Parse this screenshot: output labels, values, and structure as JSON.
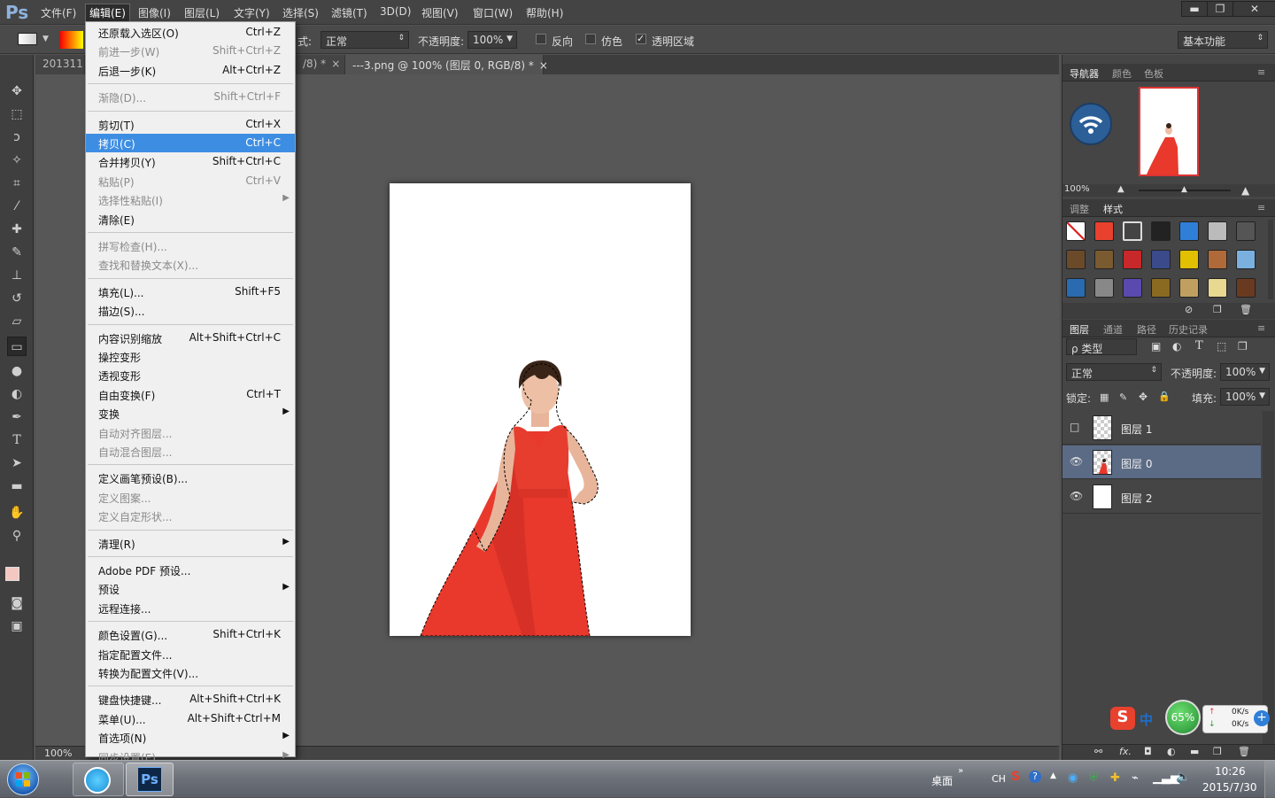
{
  "app": {
    "logo": "Ps"
  },
  "menubar": {
    "items": [
      "文件(F)",
      "编辑(E)",
      "图像(I)",
      "图层(L)",
      "文字(Y)",
      "选择(S)",
      "滤镜(T)",
      "3D(D)",
      "视图(V)",
      "窗口(W)",
      "帮助(H)"
    ],
    "active_index": 1,
    "window_buttons": {
      "minimize": "▬",
      "restore": "❐",
      "close": "✕"
    }
  },
  "options": {
    "mode_label": "式:",
    "mode_value": "正常",
    "opacity_label": "不透明度:",
    "opacity_value": "100%",
    "reverse_label": "反向",
    "dither_label": "仿色",
    "transparency_label": "透明区域",
    "transparency_checked": true,
    "workspace_value": "基本功能"
  },
  "tabs": [
    {
      "label": "201311"
    },
    {
      "label": "/8) *"
    },
    {
      "label": "---3.png @ 100% (图层 0, RGB/8) *"
    }
  ],
  "status": {
    "zoom": "100%"
  },
  "edit_menu": {
    "groups": [
      [
        {
          "label": "还原载入选区(O)",
          "shortcut": "Ctrl+Z",
          "enabled": true
        },
        {
          "label": "前进一步(W)",
          "shortcut": "Shift+Ctrl+Z",
          "enabled": false
        },
        {
          "label": "后退一步(K)",
          "shortcut": "Alt+Ctrl+Z",
          "enabled": true
        }
      ],
      [
        {
          "label": "渐隐(D)...",
          "shortcut": "Shift+Ctrl+F",
          "enabled": false
        }
      ],
      [
        {
          "label": "剪切(T)",
          "shortcut": "Ctrl+X",
          "enabled": true
        },
        {
          "label": "拷贝(C)",
          "shortcut": "Ctrl+C",
          "enabled": true,
          "highlighted": true
        },
        {
          "label": "合并拷贝(Y)",
          "shortcut": "Shift+Ctrl+C",
          "enabled": true
        },
        {
          "label": "粘贴(P)",
          "shortcut": "Ctrl+V",
          "enabled": false
        },
        {
          "label": "选择性粘贴(I)",
          "shortcut": "",
          "enabled": false,
          "submenu": true
        },
        {
          "label": "清除(E)",
          "shortcut": "",
          "enabled": true
        }
      ],
      [
        {
          "label": "拼写检查(H)...",
          "shortcut": "",
          "enabled": false
        },
        {
          "label": "查找和替换文本(X)...",
          "shortcut": "",
          "enabled": false
        }
      ],
      [
        {
          "label": "填充(L)...",
          "shortcut": "Shift+F5",
          "enabled": true
        },
        {
          "label": "描边(S)...",
          "shortcut": "",
          "enabled": true
        }
      ],
      [
        {
          "label": "内容识别缩放",
          "shortcut": "Alt+Shift+Ctrl+C",
          "enabled": true
        },
        {
          "label": "操控变形",
          "shortcut": "",
          "enabled": true
        },
        {
          "label": "透视变形",
          "shortcut": "",
          "enabled": true
        },
        {
          "label": "自由变换(F)",
          "shortcut": "Ctrl+T",
          "enabled": true
        },
        {
          "label": "变换",
          "shortcut": "",
          "enabled": true,
          "submenu": true
        },
        {
          "label": "自动对齐图层...",
          "shortcut": "",
          "enabled": false
        },
        {
          "label": "自动混合图层...",
          "shortcut": "",
          "enabled": false
        }
      ],
      [
        {
          "label": "定义画笔预设(B)...",
          "shortcut": "",
          "enabled": true
        },
        {
          "label": "定义图案...",
          "shortcut": "",
          "enabled": false
        },
        {
          "label": "定义自定形状...",
          "shortcut": "",
          "enabled": false
        }
      ],
      [
        {
          "label": "清理(R)",
          "shortcut": "",
          "enabled": true,
          "submenu": true
        }
      ],
      [
        {
          "label": "Adobe PDF 预设...",
          "shortcut": "",
          "enabled": true
        },
        {
          "label": "预设",
          "shortcut": "",
          "enabled": true,
          "submenu": true
        },
        {
          "label": "远程连接...",
          "shortcut": "",
          "enabled": true
        }
      ],
      [
        {
          "label": "颜色设置(G)...",
          "shortcut": "Shift+Ctrl+K",
          "enabled": true
        },
        {
          "label": "指定配置文件...",
          "shortcut": "",
          "enabled": true
        },
        {
          "label": "转换为配置文件(V)...",
          "shortcut": "",
          "enabled": true
        }
      ],
      [
        {
          "label": "键盘快捷键...",
          "shortcut": "Alt+Shift+Ctrl+K",
          "enabled": true
        },
        {
          "label": "菜单(U)...",
          "shortcut": "Alt+Shift+Ctrl+M",
          "enabled": true
        },
        {
          "label": "首选项(N)",
          "shortcut": "",
          "enabled": true,
          "submenu": true
        },
        {
          "label": "同步设置(E)",
          "shortcut": "",
          "enabled": false,
          "submenu": true
        }
      ]
    ]
  },
  "navigator": {
    "tabs": [
      "导航器",
      "颜色",
      "色板"
    ],
    "zoom": "100%"
  },
  "styles_panel": {
    "tabs": [
      "调整",
      "样式"
    ]
  },
  "layers_panel": {
    "tabs": [
      "图层",
      "通道",
      "路径",
      "历史记录"
    ],
    "filter_label": "ρ 类型",
    "blend_mode": "正常",
    "opacity_label": "不透明度:",
    "opacity_value": "100%",
    "lock_label": "锁定:",
    "fill_label": "填充:",
    "fill_value": "100%",
    "layers": [
      {
        "name": "图层 1",
        "visible": false,
        "selected": false
      },
      {
        "name": "图层 0",
        "visible": true,
        "selected": true
      },
      {
        "name": "图层 2",
        "visible": true,
        "selected": false
      }
    ]
  },
  "overlay_widget": {
    "ime_label": "中",
    "percent": "65%",
    "up_speed": "0K/s",
    "down_speed": "0K/s"
  },
  "taskbar": {
    "desktop_label": "桌面",
    "lang": "CH",
    "time": "10:26",
    "date": "2015/7/30"
  },
  "colors": {
    "accent_highlight": "#3d8ee3",
    "selected_layer": "#5b6b85",
    "dress_red": "#e8392c",
    "progress_green": "#3fae4a"
  }
}
